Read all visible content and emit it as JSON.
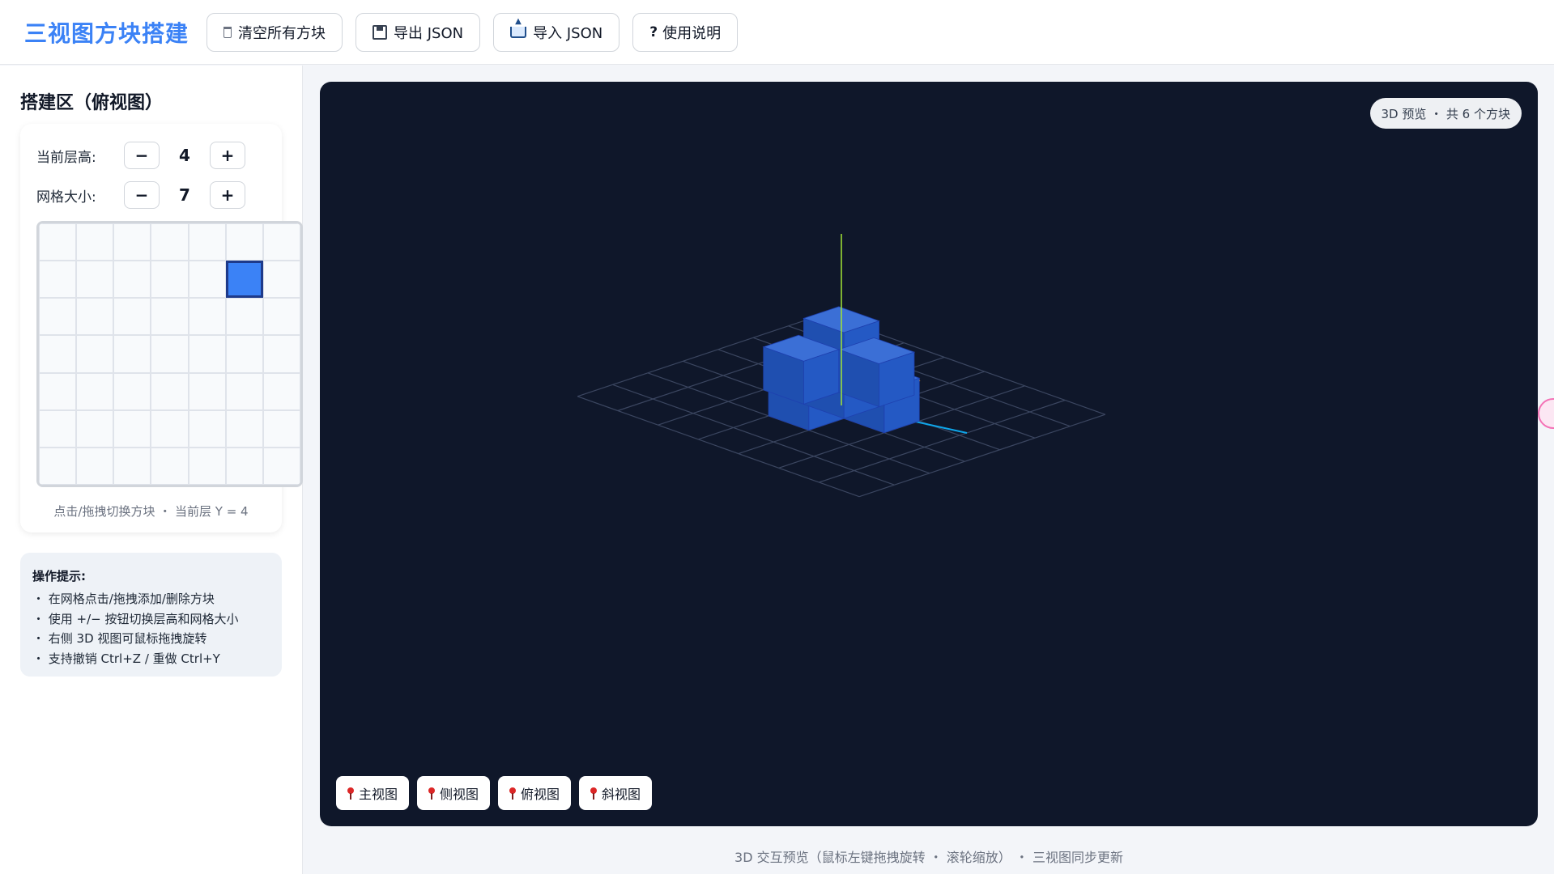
{
  "header": {
    "title": "三视图方块搭建",
    "buttons": {
      "clear": "清空所有方块",
      "export": "导出 JSON",
      "import": "导入 JSON",
      "help": "使用说明"
    }
  },
  "sidebar": {
    "title": "搭建区（俯视图）",
    "layer": {
      "label": "当前层高:",
      "value": "4",
      "minus": "−",
      "plus": "+"
    },
    "gridsize": {
      "label": "网格大小:",
      "value": "7",
      "minus": "−",
      "plus": "+"
    },
    "grid": {
      "size": 7,
      "filled": [
        [
          1,
          5
        ]
      ]
    },
    "grid_caption": "点击/拖拽切换方块 ・ 当前层 Y = 4",
    "tips": {
      "title": "操作提示:",
      "items": [
        "・ 在网格点击/拖拽添加/删除方块",
        "・ 使用 +/− 按钮切换层高和网格大小",
        "・ 右侧 3D 视图可鼠标拖拽旋转",
        "・ 支持撤销 Ctrl+Z / 重做 Ctrl+Y"
      ]
    }
  },
  "viewport": {
    "badge": "3D 预览 ・ 共 6 个方块",
    "view_buttons": [
      "主视图",
      "侧视图",
      "俯视图",
      "斜视图"
    ],
    "colors": {
      "background": "#0f172a",
      "cube": "#2563eb",
      "y_axis": "#a3e635",
      "x_axis": "#f59e0b",
      "z_axis": "#0ea5e9",
      "grid_line": "#3b4660"
    }
  },
  "footer_note": "3D 交互预览（鼠标左键拖拽旋转 ・ 滚轮缩放） ・ 三视图同步更新"
}
